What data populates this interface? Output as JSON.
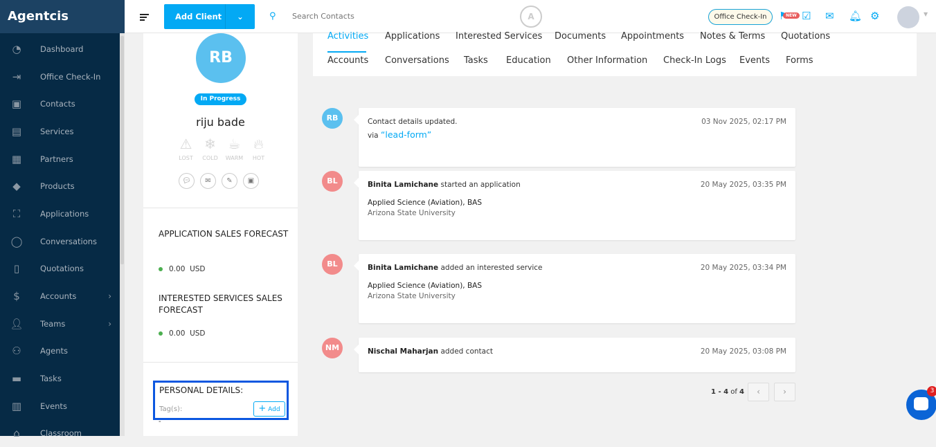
{
  "app": {
    "title": "Agentcis"
  },
  "sidebar": {
    "items": [
      {
        "label": "Dashboard",
        "icon": "dashboard-icon"
      },
      {
        "label": "Office Check-In",
        "icon": "check-in-icon"
      },
      {
        "label": "Contacts",
        "icon": "contacts-icon"
      },
      {
        "label": "Services",
        "icon": "services-icon"
      },
      {
        "label": "Partners",
        "icon": "partners-icon"
      },
      {
        "label": "Products",
        "icon": "products-icon"
      },
      {
        "label": "Applications",
        "icon": "applications-icon"
      },
      {
        "label": "Conversations",
        "icon": "conversations-icon"
      },
      {
        "label": "Quotations",
        "icon": "quotations-icon"
      },
      {
        "label": "Accounts",
        "icon": "accounts-icon",
        "submenu": true
      },
      {
        "label": "Teams",
        "icon": "teams-icon",
        "submenu": true
      },
      {
        "label": "Agents",
        "icon": "agents-icon"
      },
      {
        "label": "Tasks",
        "icon": "tasks-icon"
      },
      {
        "label": "Events",
        "icon": "events-icon"
      },
      {
        "label": "Classroom",
        "icon": "classroom-icon"
      }
    ]
  },
  "header": {
    "add_client": "Add Client",
    "search_placeholder": "Search Contacts",
    "office_checkin": "Office Check-In",
    "new_badge": "NEW"
  },
  "profile": {
    "initials": "RB",
    "status": "In Progress",
    "name": "riju bade",
    "ratings": [
      "LOST",
      "COLD",
      "WARM",
      "HOT"
    ],
    "app_forecast_title": "APPLICATION SALES FORECAST",
    "app_forecast_value": "0.00",
    "app_forecast_currency": "USD",
    "svc_forecast_title": "INTERESTED SERVICES SALES FORECAST",
    "svc_forecast_value": "0.00",
    "svc_forecast_currency": "USD",
    "personal_title": "PERSONAL DETAILS:",
    "tags_label": "Tag(s):",
    "add_label": "Add",
    "tags_value": "-"
  },
  "tabs": {
    "row1": [
      "Activities",
      "Applications",
      "Interested Services",
      "Documents",
      "Appointments",
      "Notes & Terms",
      "Quotations"
    ],
    "row2": [
      "Accounts",
      "Conversations",
      "Tasks",
      "Education",
      "Other Information",
      "Check-In Logs",
      "Events",
      "Forms"
    ],
    "active": "Activities"
  },
  "activities": [
    {
      "initials": "RB",
      "color": "#5bc0ef",
      "actor": "",
      "text": "Contact details updated.",
      "via": "via",
      "link": "“lead-form”",
      "date": "03 Nov 2025, 02:17 PM"
    },
    {
      "initials": "BL",
      "color": "#f28b8b",
      "actor": "Binita Lamichane",
      "text": " started an application",
      "title": "Applied Science (Aviation), BAS",
      "sub": "Arizona State University",
      "date": "20 May 2025, 03:35 PM"
    },
    {
      "initials": "BL",
      "color": "#f28b8b",
      "actor": "Binita Lamichane",
      "text": " added an interested service",
      "title": "Applied Science (Aviation), BAS",
      "sub": "Arizona State University",
      "date": "20 May 2025, 03:34 PM"
    },
    {
      "initials": "NM",
      "color": "#f28b8b",
      "actor": "Nischal Maharjan",
      "text": " added contact",
      "date": "20 May 2025, 03:08 PM"
    }
  ],
  "pagination": {
    "range": "1 - 4",
    "of": "of",
    "total": "4"
  },
  "chat": {
    "badge": "3"
  }
}
